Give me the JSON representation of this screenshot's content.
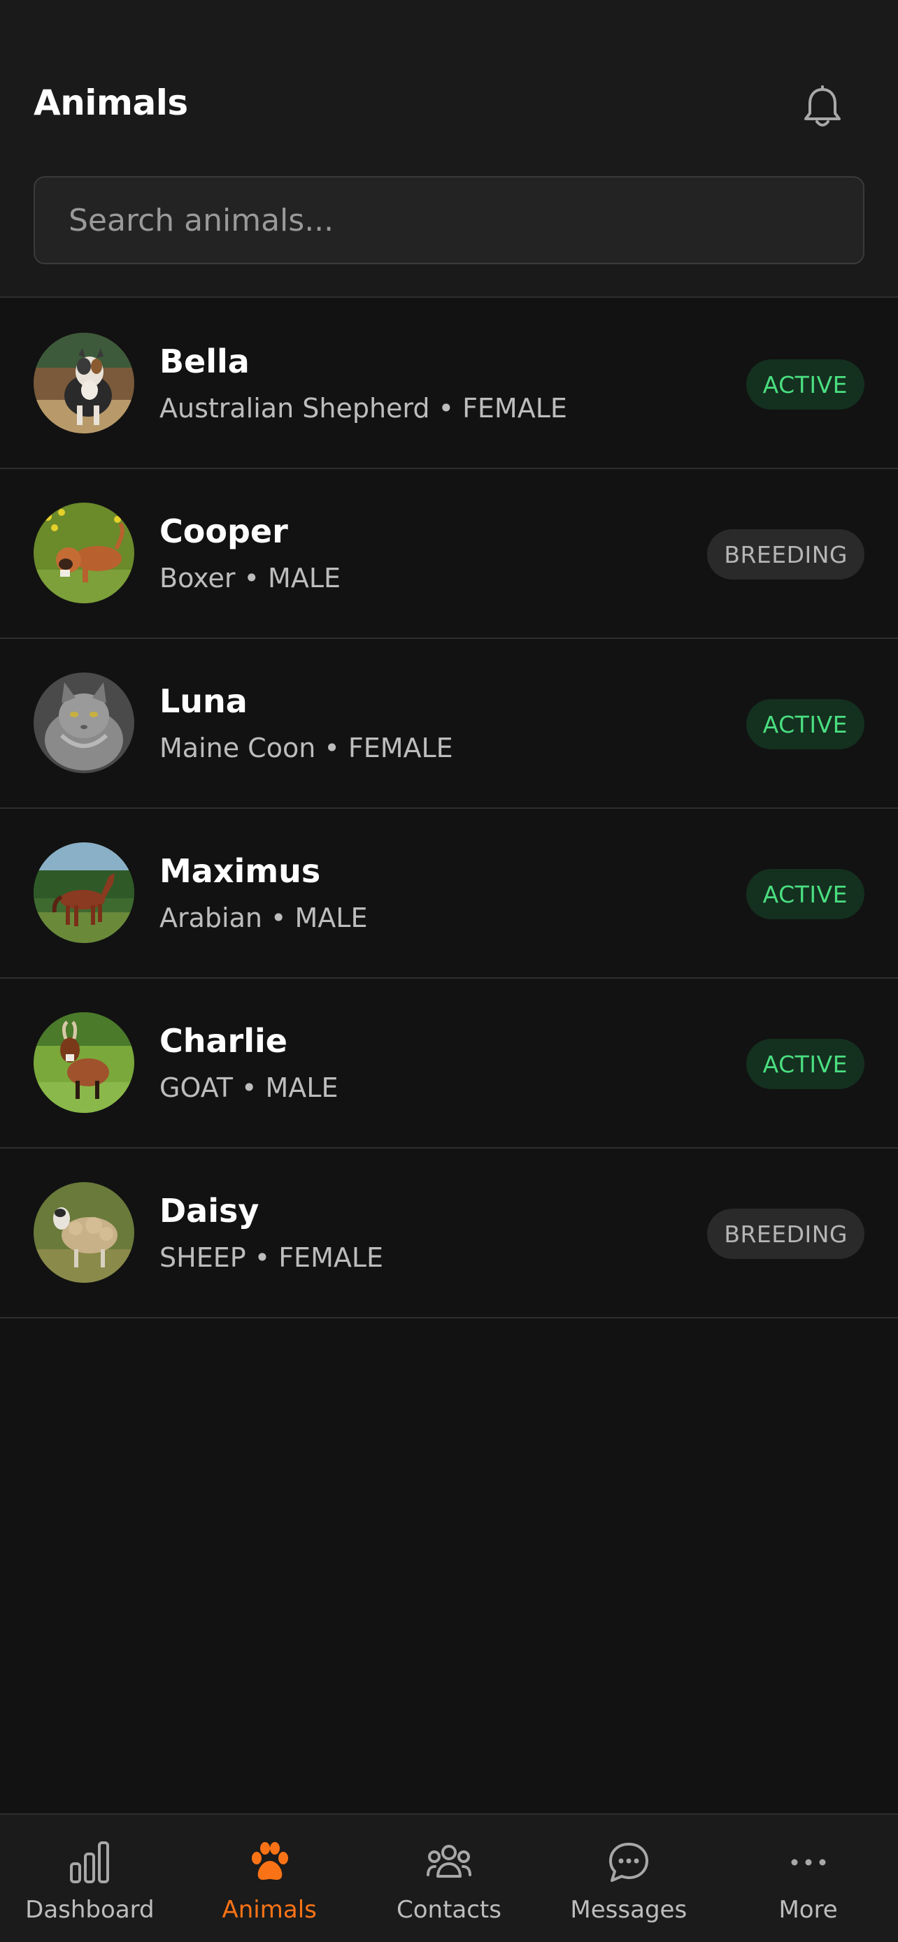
{
  "header": {
    "title": "Animals",
    "notification_icon": "bell-icon"
  },
  "search": {
    "placeholder": "Search animals...",
    "value": ""
  },
  "animals": [
    {
      "name": "Bella",
      "subtitle": "Australian Shepherd • FEMALE",
      "status": "ACTIVE",
      "photo": "australian-shepherd-photo"
    },
    {
      "name": "Cooper",
      "subtitle": "Boxer • MALE",
      "status": "BREEDING",
      "photo": "boxer-photo"
    },
    {
      "name": "Luna",
      "subtitle": "Maine Coon • FEMALE",
      "status": "ACTIVE",
      "photo": "maine-coon-photo"
    },
    {
      "name": "Maximus",
      "subtitle": "Arabian • MALE",
      "status": "ACTIVE",
      "photo": "arabian-horse-photo"
    },
    {
      "name": "Charlie",
      "subtitle": "GOAT • MALE",
      "status": "ACTIVE",
      "photo": "goat-photo"
    },
    {
      "name": "Daisy",
      "subtitle": "SHEEP • FEMALE",
      "status": "BREEDING",
      "photo": "sheep-photo"
    }
  ],
  "tabbar": {
    "items": [
      {
        "label": "Dashboard",
        "icon": "bar-chart-icon",
        "active": false
      },
      {
        "label": "Animals",
        "icon": "paw-icon",
        "active": true
      },
      {
        "label": "Contacts",
        "icon": "people-icon",
        "active": false
      },
      {
        "label": "Messages",
        "icon": "chat-icon",
        "active": false
      },
      {
        "label": "More",
        "icon": "more-icon",
        "active": false
      }
    ]
  },
  "colors": {
    "background": "#121212",
    "header": "#1a1a1a",
    "accent": "#f97316",
    "active_badge_text": "#4ade80",
    "active_badge_bg": "#14301f",
    "breeding_badge_bg": "#2a2a2a"
  }
}
